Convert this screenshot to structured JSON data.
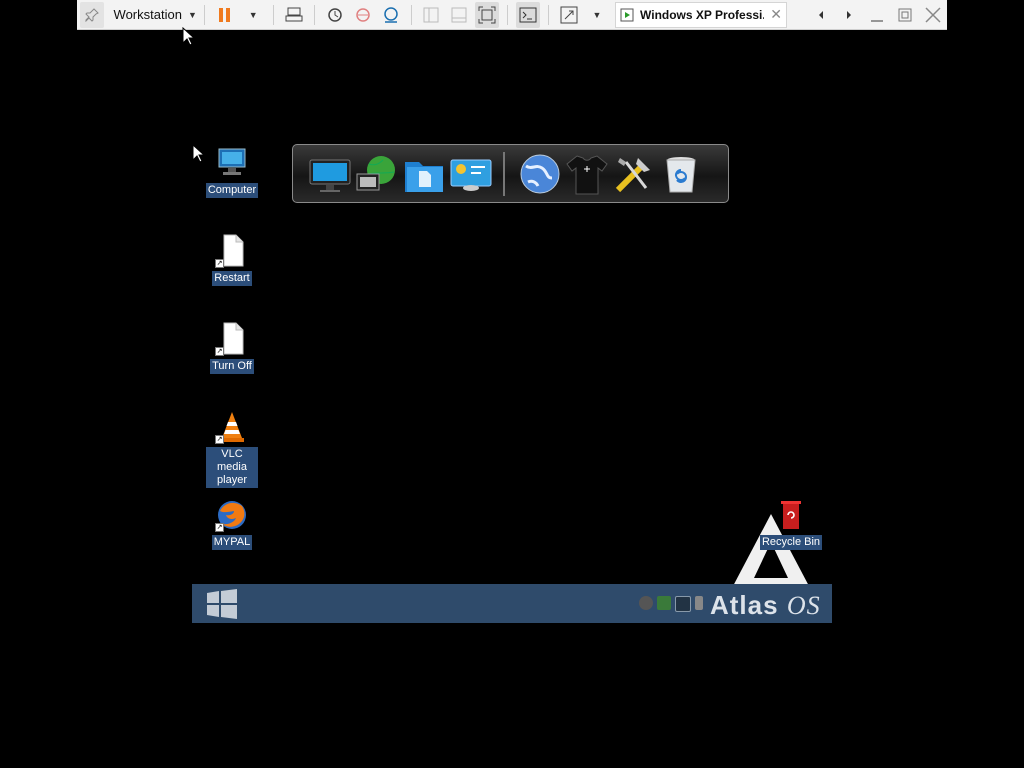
{
  "toolbar": {
    "workstation_label": "Workstation",
    "vm_tab_title": "Windows XP Professi...",
    "tab_close": "✕"
  },
  "desktop": {
    "icons": [
      {
        "label": "Computer",
        "icon": "computer-icon"
      },
      {
        "label": "Restart",
        "icon": "document-shortcut-icon"
      },
      {
        "label": "Turn Off",
        "icon": "document-shortcut-icon"
      },
      {
        "label": "VLC media player",
        "icon": "vlc-cone-icon"
      },
      {
        "label": "MYPAL",
        "icon": "browser-globe-icon"
      },
      {
        "label": "Recycle Bin",
        "icon": "recycle-bin-icon"
      }
    ]
  },
  "dock": {
    "items": [
      "monitor-icon",
      "network-globe-icon",
      "folder-documents-icon",
      "control-panel-icon",
      "internet-globe-icon",
      "theme-shirt-icon",
      "tools-icon",
      "trash-icon"
    ]
  },
  "taskbar": {
    "brand_text": "Atlas",
    "brand_suffix": "OS"
  },
  "colors": {
    "desktop_bg": "#000000",
    "taskbar_bg": "#2f4b6b",
    "label_bg": "#2c4e7a",
    "pause_accent": "#f07a1e"
  }
}
